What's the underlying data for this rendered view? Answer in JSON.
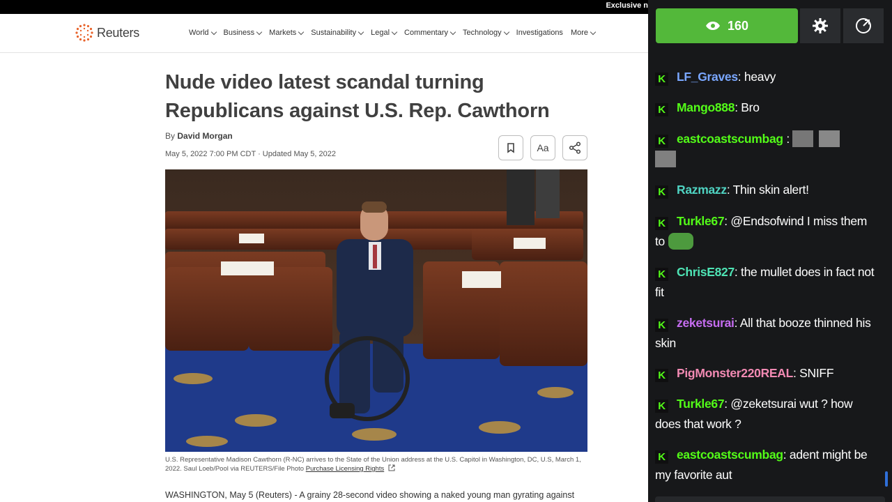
{
  "topbar": {
    "exclusive": "Exclusive n"
  },
  "site": {
    "logo_text": "Reuters",
    "menu": [
      {
        "label": "World",
        "dropdown": true
      },
      {
        "label": "Business",
        "dropdown": true
      },
      {
        "label": "Markets",
        "dropdown": true
      },
      {
        "label": "Sustainability",
        "dropdown": true
      },
      {
        "label": "Legal",
        "dropdown": true
      },
      {
        "label": "Commentary",
        "dropdown": true
      },
      {
        "label": "Technology",
        "dropdown": true
      },
      {
        "label": "Investigations",
        "dropdown": false
      },
      {
        "label": "More",
        "dropdown": true
      }
    ]
  },
  "article": {
    "headline": "Nude video latest scandal turning Republicans against U.S. Rep. Cawthorn",
    "by_prefix": "By",
    "author": "David Morgan",
    "date": "May 5, 2022 7:00 PM CDT · Updated May 5, 2022",
    "tools": {
      "bookmark_icon": "bookmark-icon",
      "font_label": "Aa",
      "share_icon": "share-icon"
    },
    "caption": "U.S. Representative Madison Cawthorn (R-NC) arrives to the State of the Union address at the U.S. Capitol in Washington, DC, U.S, March 1, 2022. Saul Loeb/Pool via REUTERS/File Photo",
    "caption_link": "Purchase Licensing Rights",
    "body_start": "WASHINGTON, May 5 (Reuters) - A grainy 28-second video showing a naked young man gyrating against"
  },
  "chat": {
    "viewer_count": "160",
    "badge": "K",
    "colors": {
      "green": "#53b83a",
      "badge_green": "#53fc18",
      "bg": "#17181a"
    },
    "messages": [
      {
        "user": "LF_Graves",
        "color": "#7aa7ff",
        "text": ": heavy",
        "emotes": 0
      },
      {
        "user": "Mango888",
        "color": "#53fc18",
        "text": ": Bro",
        "emotes": 0
      },
      {
        "user": "eastcoastscumbag",
        "color": "#53fc18",
        "text": " : ",
        "emotes": 3
      },
      {
        "user": "Razmazz",
        "color": "#4fd3c2",
        "text": ": Thin skin alert!",
        "emotes": 0
      },
      {
        "user": "Turkle67",
        "color": "#53fc18",
        "text": ": @Endsofwind I miss them to",
        "emotes": 1
      },
      {
        "user": "ChrisE827",
        "color": "#4ee3b4",
        "text": ": the mullet does in fact not fit",
        "emotes": 0
      },
      {
        "user": "zeketsurai",
        "color": "#c56cf0",
        "text": ": All that booze thinned his skin",
        "emotes": 0
      },
      {
        "user": "PigMonster220REAL",
        "color": "#f28ab3",
        "text": ": SNIFF",
        "emotes": 0
      },
      {
        "user": "Turkle67",
        "color": "#53fc18",
        "text": ": @zeketsurai wut ? how does that work ?",
        "emotes": 0
      },
      {
        "user": "eastcoastscumbag",
        "color": "#53fc18",
        "text": ": adent might be my favorite aut",
        "emotes": 0
      }
    ]
  }
}
